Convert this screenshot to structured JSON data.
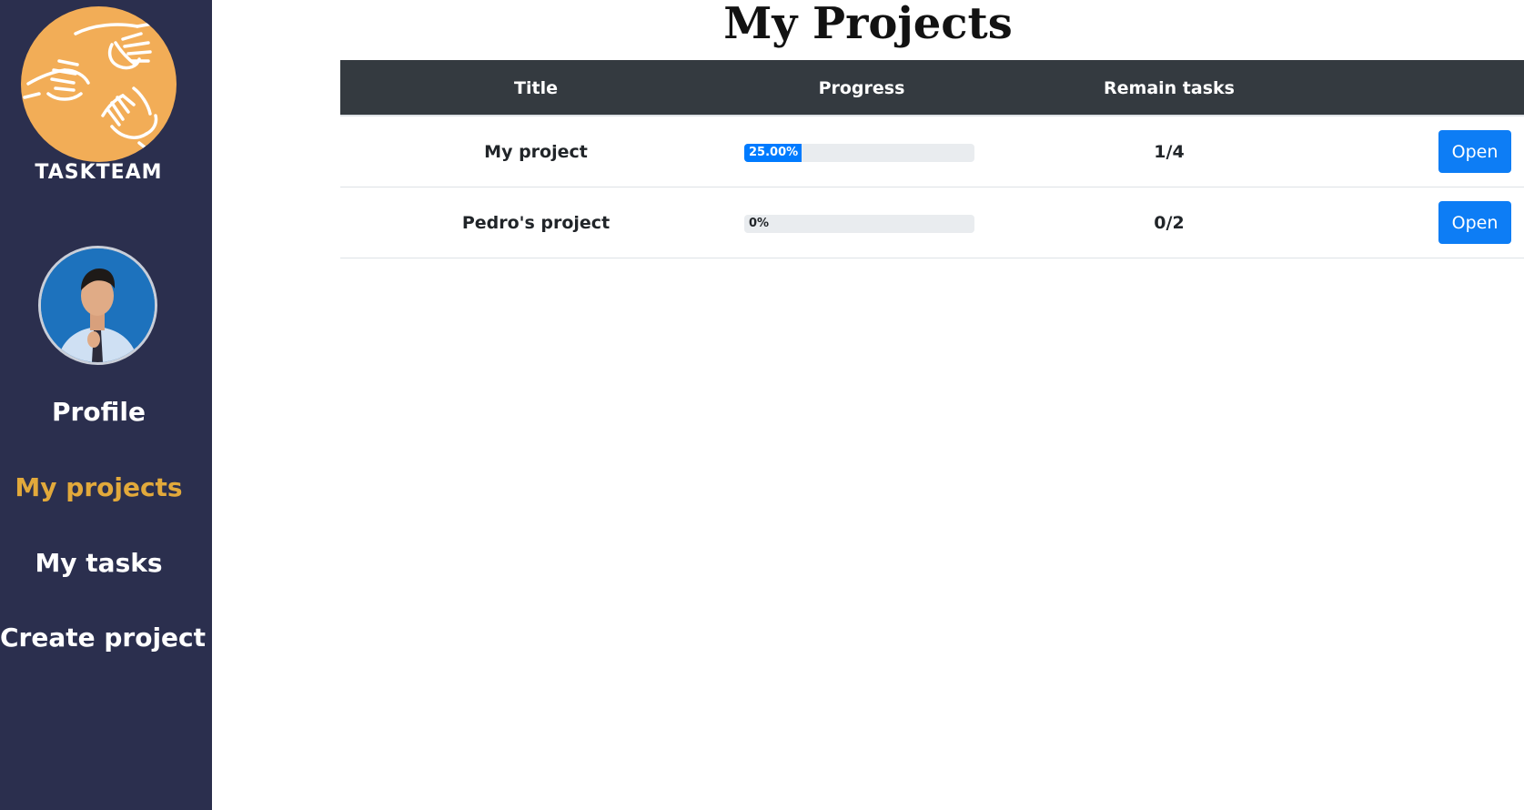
{
  "sidebar": {
    "brand": "TASKTEAM",
    "logo_icon": "helping-hands-icon",
    "logo_color": "#f2ad57",
    "background": "#2b2f4e",
    "avatar_icon": "user-avatar",
    "items": [
      {
        "label": "Profile",
        "active": false
      },
      {
        "label": "My projects",
        "active": true
      },
      {
        "label": "My tasks",
        "active": false
      },
      {
        "label": "Create project",
        "active": false
      }
    ],
    "active_color": "#e2a93b"
  },
  "main": {
    "title": "My Projects",
    "table": {
      "headers": [
        "Title",
        "Progress",
        "Remain tasks",
        ""
      ],
      "rows": [
        {
          "title": "My project",
          "progress": 25,
          "progress_label": "25.00%",
          "remain": "1/4",
          "action": "Open"
        },
        {
          "title": "Pedro's project",
          "progress": 0,
          "progress_label": "0%",
          "remain": "0/2",
          "action": "Open"
        }
      ]
    }
  },
  "colors": {
    "header_bg": "#343a40",
    "button_bg": "#0d7df5",
    "progress_fill": "#007bff",
    "progress_track": "#e9ecef"
  }
}
